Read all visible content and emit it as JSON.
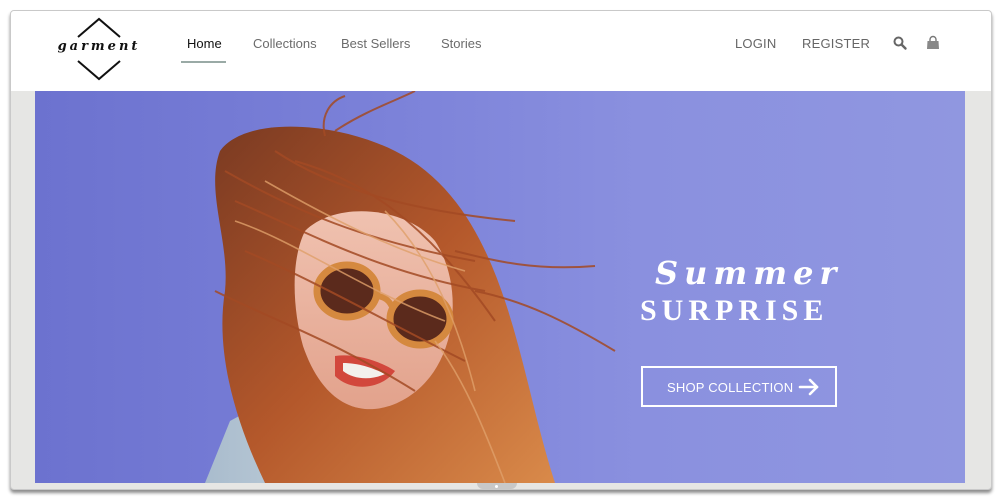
{
  "brand": {
    "logo_text": "garment"
  },
  "nav": {
    "items": [
      {
        "label": "Home",
        "active": true
      },
      {
        "label": "Collections",
        "active": false
      },
      {
        "label": "Best Sellers",
        "active": false
      },
      {
        "label": "Stories",
        "active": false
      }
    ]
  },
  "account": {
    "login_label": "LOGIN",
    "register_label": "REGISTER",
    "search_icon": "search-icon",
    "cart_icon": "shopping-bag-icon"
  },
  "hero": {
    "title_script": "Summer",
    "title_main": "SURPRISE",
    "cta_label": "SHOP COLLECTION",
    "cta_icon": "arrow-right-icon",
    "image_description": "Woman with windblown red hair and wooden sunglasses smiling against a periwinkle background",
    "background_color": "#7a80d8"
  },
  "colors": {
    "nav_active_underline": "#9aaaa6",
    "nav_text": "#6b6b6b",
    "nav_active_text": "#111111",
    "frame_background": "#e6e6e4"
  }
}
